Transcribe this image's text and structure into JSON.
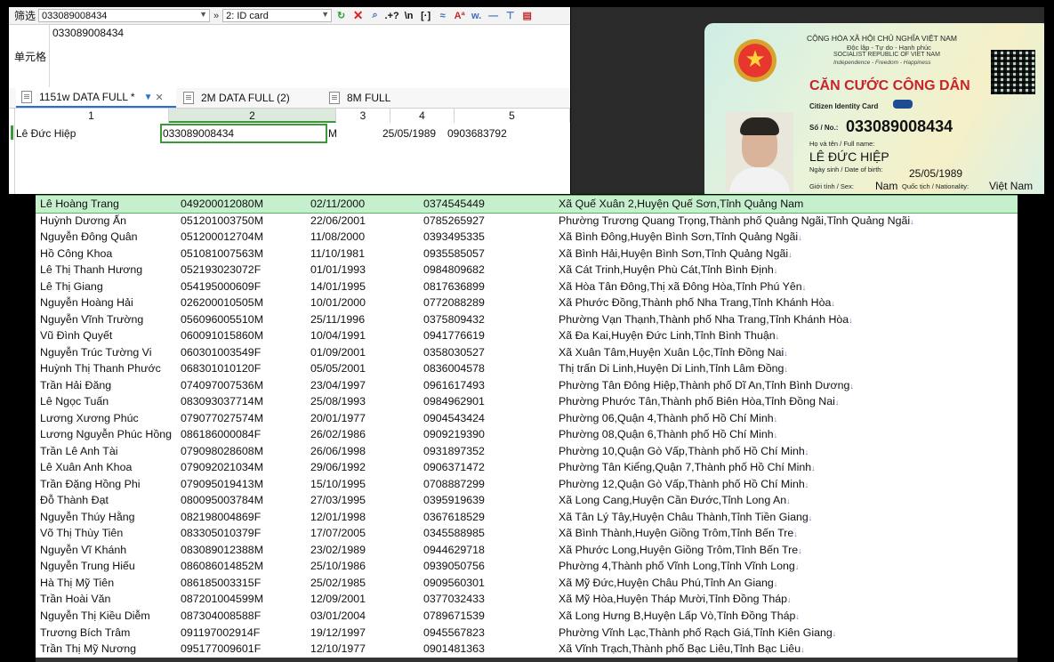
{
  "app": {
    "filter_label": "筛选",
    "filter_value": "033089008434",
    "arrows": "»",
    "column_value": "2: ID card",
    "cell_label": "单元格",
    "cell_value": "033089008434"
  },
  "tabs": [
    {
      "label": "1151w DATA FULL *"
    },
    {
      "label": "2M DATA FULL (2)"
    },
    {
      "label": "8M FULL"
    }
  ],
  "grid": {
    "headers": [
      "1",
      "2",
      "3",
      "4",
      "5"
    ],
    "row": [
      "Lê Đức Hiệp",
      "033089008434",
      "M",
      "25/05/1989",
      "0903683792"
    ]
  },
  "card": {
    "l1": "CỘNG HÒA XÃ HỘI CHỦ NGHĨA VIỆT NAM",
    "l2": "Độc lập - Tự do - Hạnh phúc",
    "l3": "SOCIALIST REPUBLIC OF VIET NAM",
    "l4": "Independence - Freedom - Happiness",
    "title": "CĂN CƯỚC CÔNG DÂN",
    "subtitle": "Citizen Identity Card",
    "no_label": "Số / No.:",
    "number": "033089008434",
    "name_label": "Họ và tên / Full name:",
    "name": "LÊ ĐỨC HIỆP",
    "dob_label": "Ngày sinh / Date of birth:",
    "dob": "25/05/1989",
    "sex_label": "Giới tính / Sex:",
    "sex": "Nam",
    "nat_label": "Quốc tịch / Nationality:",
    "nat": "Việt Nam"
  },
  "rows": [
    [
      "Lê Hoàng Trang",
      "049200012080M",
      "02/11/2000",
      "0374545449",
      "Xã Quế Xuân 2,Huyện Quế Sơn,Tỉnh Quảng Nam"
    ],
    [
      "Huỳnh Dương Ấn",
      "051201003750M",
      "22/06/2001",
      "0785265927",
      "Phường Trương Quang Trọng,Thành phố Quảng Ngãi,Tỉnh Quảng Ngãi"
    ],
    [
      "Nguyễn Đông Quân",
      "051200012704M",
      "11/08/2000",
      "0393495335",
      "Xã Bình Đông,Huyện Bình Sơn,Tỉnh Quảng Ngãi"
    ],
    [
      "Hồ Công Khoa",
      "051081007563M",
      "11/10/1981",
      "0935585057",
      "Xã Bình Hải,Huyện Bình Sơn,Tỉnh Quảng Ngãi"
    ],
    [
      "Lê Thị Thanh Hương",
      "052193023072F",
      "01/01/1993",
      "0984809682",
      "Xã Cát Trinh,Huyện Phù Cát,Tỉnh Bình Định"
    ],
    [
      "Lê Thị Giang",
      "054195000609F",
      "14/01/1995",
      "0817636899",
      "Xã Hòa Tân Đông,Thị xã Đông Hòa,Tỉnh Phú Yên"
    ],
    [
      "Nguyễn Hoàng Hải",
      "026200010505M",
      "10/01/2000",
      "0772088289",
      "Xã Phước Đồng,Thành phố Nha Trang,Tỉnh Khánh Hòa"
    ],
    [
      "Nguyễn Vĩnh Trường",
      "056096005510M",
      "25/11/1996",
      "0375809432",
      "Phường Vạn Thạnh,Thành phố Nha Trang,Tỉnh Khánh Hòa"
    ],
    [
      "Vũ Đình Quyết",
      "060091015860M",
      "10/04/1991",
      "0941776619",
      "Xã Đa Kai,Huyện Đức Linh,Tỉnh Bình Thuận"
    ],
    [
      "Nguyễn Trúc Tường Vi",
      "060301003549F",
      "01/09/2001",
      "0358030527",
      "Xã Xuân Tâm,Huyện Xuân Lộc,Tỉnh Đồng Nai"
    ],
    [
      "Huỳnh Thị Thanh Phước",
      "068301010120F",
      "05/05/2001",
      "0836004578",
      "Thị trấn Di Linh,Huyện Di Linh,Tỉnh Lâm Đồng"
    ],
    [
      "Trần Hải Đăng",
      "074097007536M",
      "23/04/1997",
      "0961617493",
      "Phường Tân Đông Hiệp,Thành phố Dĩ An,Tỉnh Bình Dương"
    ],
    [
      "Lê Ngọc Tuấn",
      "083093037714M",
      "25/08/1993",
      "0984962901",
      "Phường Phước Tân,Thành phố Biên Hòa,Tỉnh Đồng Nai"
    ],
    [
      "Lương Xương Phúc",
      "079077027574M",
      "20/01/1977",
      "0904543424",
      "Phường 06,Quận 4,Thành phố Hồ Chí Minh"
    ],
    [
      "Lương Nguyễn Phúc Hồng",
      "086186000084F",
      "26/02/1986",
      "0909219390",
      "Phường 08,Quận 6,Thành phố Hồ Chí Minh"
    ],
    [
      "Trần Lê Anh Tài",
      "079098028608M",
      "26/06/1998",
      "0931897352",
      "Phường 10,Quận Gò Vấp,Thành phố Hồ Chí Minh"
    ],
    [
      "Lê Xuân Anh Khoa",
      "079092021034M",
      "29/06/1992",
      "0906371472",
      "Phường Tân Kiểng,Quận 7,Thành phố Hồ Chí Minh"
    ],
    [
      "Trần Đặng Hồng Phi",
      "079095019413M",
      "15/10/1995",
      "0708887299",
      "Phường 12,Quận Gò Vấp,Thành phố Hồ Chí Minh"
    ],
    [
      "Đỗ Thành Đạt",
      "080095003784M",
      "27/03/1995",
      "0395919639",
      "Xã Long Cang,Huyện Cần Đước,Tỉnh Long An"
    ],
    [
      "Nguyễn Thúy Hằng",
      "082198004869F",
      "12/01/1998",
      "0367618529",
      "Xã Tân Lý Tây,Huyện Châu Thành,Tỉnh Tiền Giang"
    ],
    [
      "Võ Thị Thùy Tiên",
      "083305010379F",
      "17/07/2005",
      "0345588985",
      "Xã Bình Thành,Huyện Giồng Trôm,Tỉnh Bến Tre"
    ],
    [
      "Nguyễn Vĩ Khánh",
      "083089012388M",
      "23/02/1989",
      "0944629718",
      "Xã Phước Long,Huyện Giồng Trôm,Tỉnh Bến Tre"
    ],
    [
      "Nguyễn Trung Hiếu",
      "086086014852M",
      "25/10/1986",
      "0939050756",
      "Phường 4,Thành phố Vĩnh Long,Tỉnh Vĩnh Long"
    ],
    [
      "Hà Thị Mỹ Tiên",
      "086185003315F",
      "25/02/1985",
      "0909560301",
      "Xã Mỹ Đức,Huyện Châu Phú,Tỉnh An Giang"
    ],
    [
      "Trần Hoài Văn",
      "087201004599M",
      "12/09/2001",
      "0377032433",
      "Xã Mỹ Hòa,Huyện Tháp Mười,Tỉnh Đồng Tháp"
    ],
    [
      "Nguyễn Thị Kiều Diễm",
      "087304008588F",
      "03/01/2004",
      "0789671539",
      "Xã Long Hưng B,Huyện Lấp Vò,Tỉnh Đồng Tháp"
    ],
    [
      "Trương Bích Trâm",
      "091197002914F",
      "19/12/1997",
      "0945567823",
      "Phường Vĩnh Lạc,Thành phố Rạch Giá,Tỉnh Kiên Giang"
    ],
    [
      "Trần Thị Mỹ Nương",
      "095177009601F",
      "12/10/1977",
      "0901481363",
      "Xã Vĩnh Trạch,Thành phố Bạc Liêu,Tỉnh Bạc Liêu"
    ]
  ]
}
